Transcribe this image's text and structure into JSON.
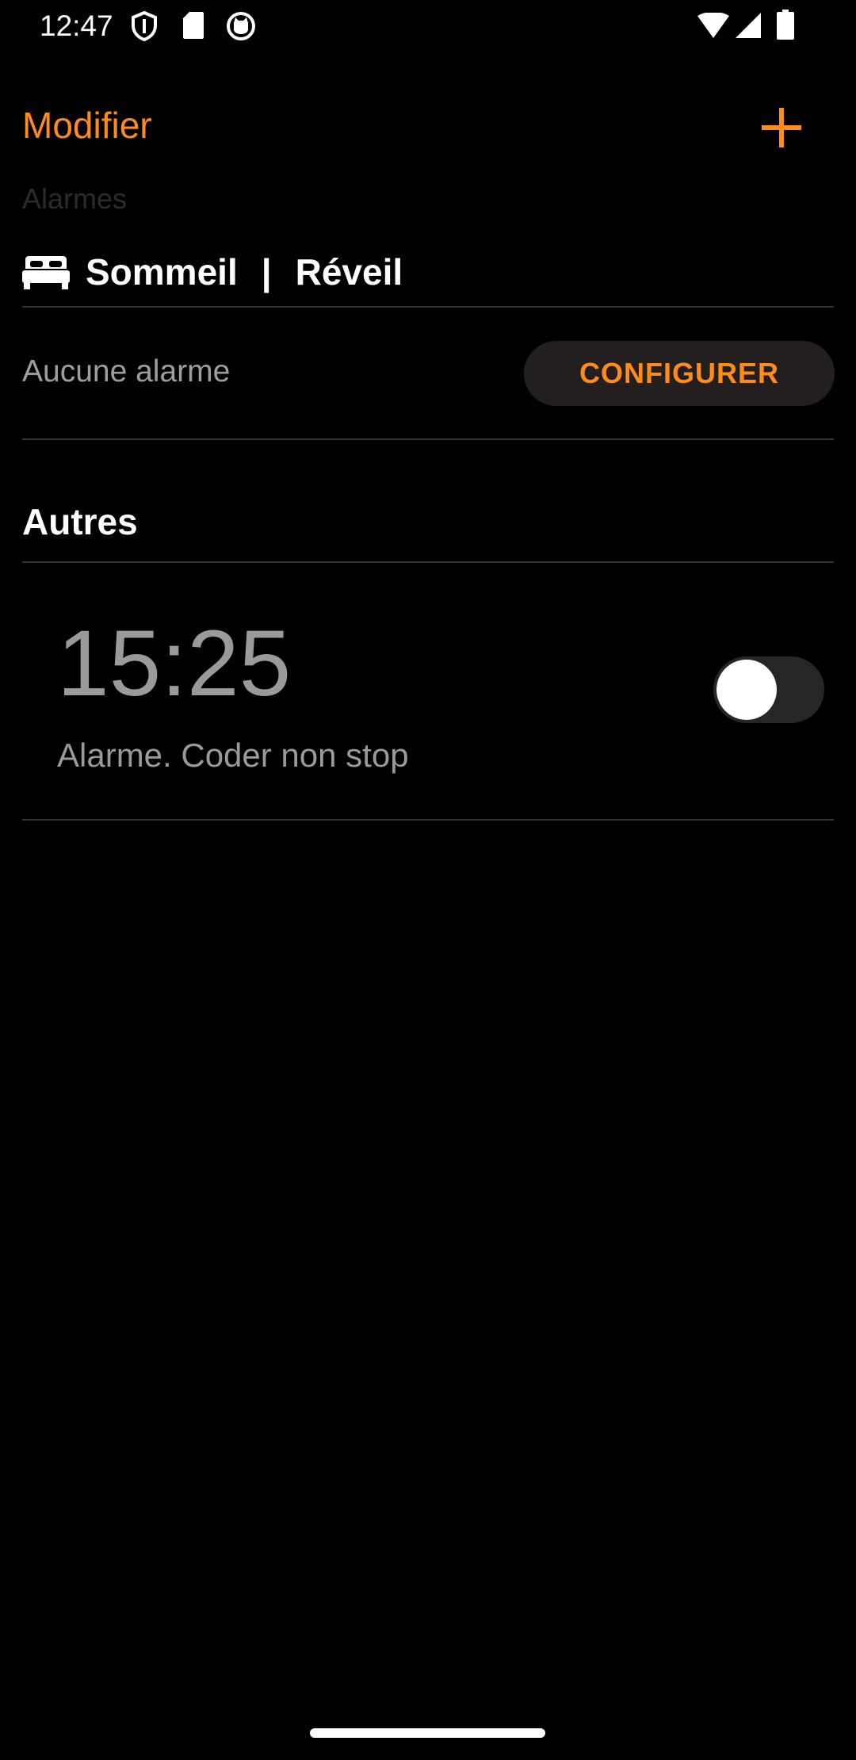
{
  "status_bar": {
    "time": "12:47",
    "icons": [
      "vpn-shield-icon",
      "sd-card-icon",
      "cat-icon",
      "wifi-icon",
      "cell-signal-icon",
      "battery-icon"
    ]
  },
  "nav": {
    "edit_label": "Modifier",
    "add_icon": "plus-icon"
  },
  "section_caption": "Alarmes",
  "sleep_section": {
    "icon": "bed-icon",
    "sleep_label": "Sommeil",
    "separator": "|",
    "wake_label": "Réveil",
    "empty_text": "Aucune alarme",
    "configure_label": "CONFIGURER"
  },
  "others": {
    "title": "Autres",
    "alarms": [
      {
        "time": "15:25",
        "label": "Alarme. Coder non stop",
        "enabled": false
      }
    ]
  },
  "colors": {
    "accent": "#ff8c1a",
    "background": "#000000",
    "muted_text": "#9a9a9a",
    "button_bg": "#231f1f",
    "divider": "#333333"
  }
}
